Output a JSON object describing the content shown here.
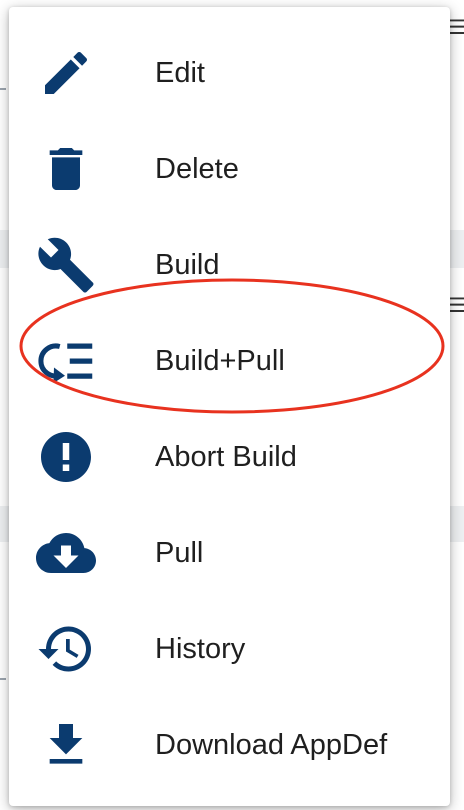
{
  "colors": {
    "icon": "#0b3b6f",
    "label": "#1f1f1f",
    "highlight": "#e8321f",
    "menu_bg": "#ffffff"
  },
  "menu": {
    "items": [
      {
        "label": "Edit",
        "icon": "pencil-icon"
      },
      {
        "label": "Delete",
        "icon": "trash-icon"
      },
      {
        "label": "Build",
        "icon": "wrench-icon"
      },
      {
        "label": "Build+Pull",
        "icon": "build-pull-icon",
        "highlighted": true
      },
      {
        "label": "Abort Build",
        "icon": "exclamation-circle-icon"
      },
      {
        "label": "Pull",
        "icon": "cloud-download-icon"
      },
      {
        "label": "History",
        "icon": "history-icon"
      },
      {
        "label": "Download AppDef",
        "icon": "download-icon"
      }
    ]
  }
}
